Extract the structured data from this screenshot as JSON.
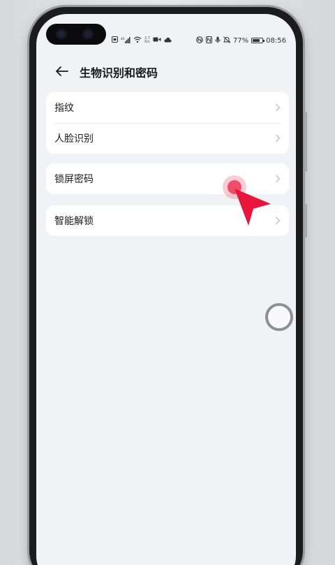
{
  "status_bar": {
    "network_speed_value": "2.7",
    "network_speed_unit": "K/s",
    "battery_percent": "77%",
    "battery_level": 0.77,
    "time": "08:56",
    "icons": [
      "sim-icon",
      "signal-icon",
      "wifi-icon",
      "video-icon",
      "cloud-icon",
      "nfc-icon",
      "nfc-n-icon",
      "mic-icon",
      "mute-icon",
      "battery-icon"
    ]
  },
  "header": {
    "title": "生物识别和密码"
  },
  "cards": [
    {
      "items": [
        {
          "label": "指纹"
        },
        {
          "label": "人脸识别"
        }
      ]
    },
    {
      "items": [
        {
          "label": "锁屏密码"
        }
      ]
    },
    {
      "items": [
        {
          "label": "智能解锁"
        }
      ]
    }
  ],
  "overlays": {
    "tap_indicator_color": "#e8163c",
    "touch_ring_color": "#8e8f93"
  },
  "colors": {
    "page_background": "#f1f2f6",
    "card_background": "#ffffff",
    "primary_text": "#1a1a1a",
    "chevron": "#c2c2c6"
  }
}
